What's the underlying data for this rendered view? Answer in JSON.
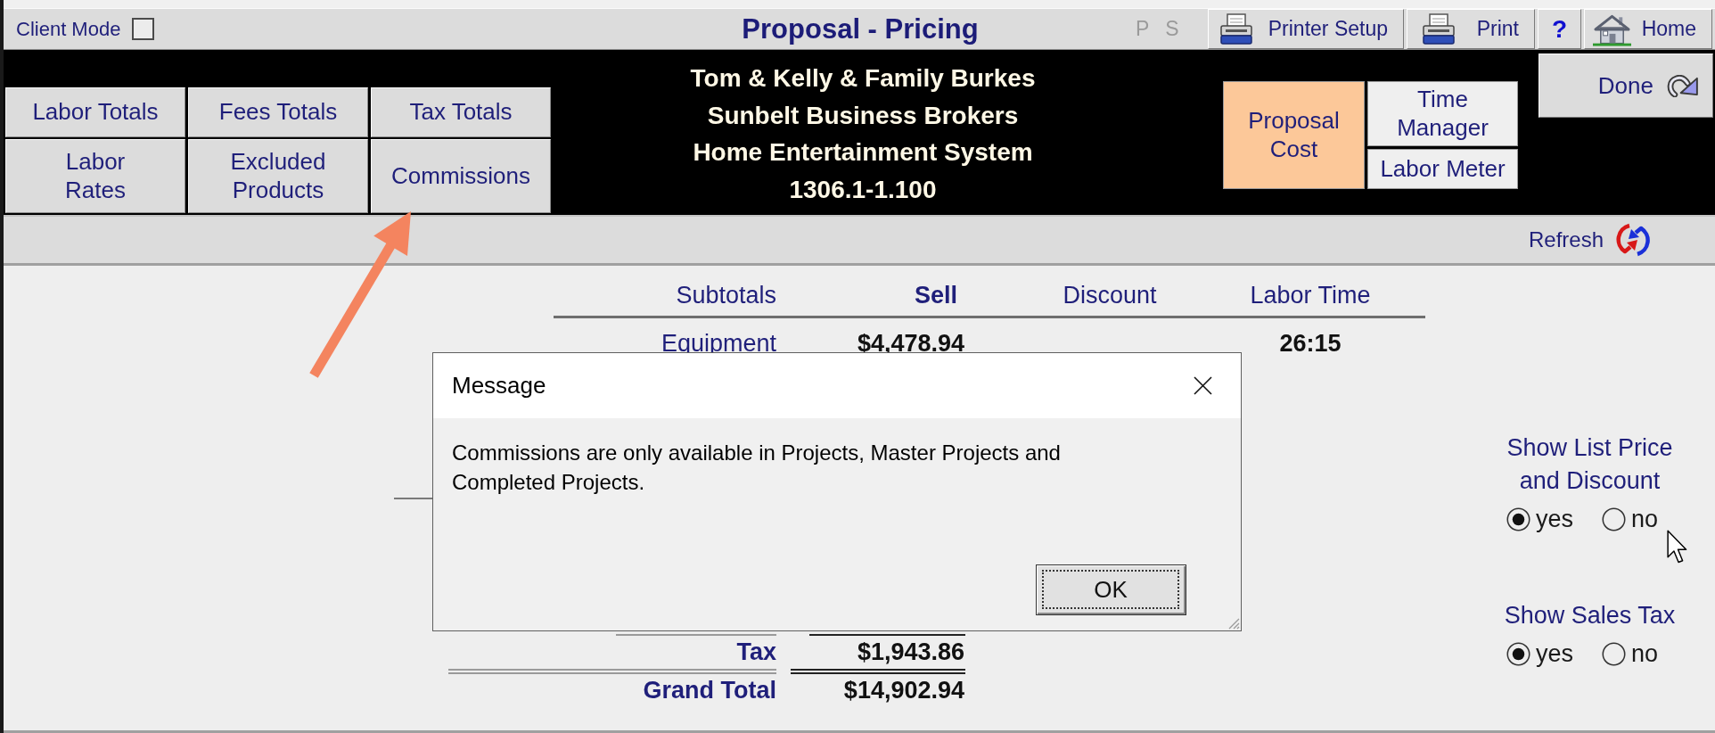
{
  "top_bar": {
    "client_mode": {
      "label": "Client Mode",
      "checked": false
    },
    "title": "Proposal - Pricing",
    "indicators": [
      "P",
      "S"
    ],
    "buttons": [
      {
        "kind": "printer-setup",
        "label": "Printer Setup"
      },
      {
        "kind": "print",
        "label": "Print"
      },
      {
        "kind": "help",
        "label": "?"
      },
      {
        "kind": "home",
        "label": "Home"
      }
    ]
  },
  "report_buttons": [
    "Labor Totals",
    "Fees Totals",
    "Tax Totals",
    "Labor\nRates",
    "Excluded\nProducts",
    "Commissions"
  ],
  "project_header": [
    "Tom & Kelly & Family Burkes",
    "Sunbelt Business Brokers",
    "Home Entertainment System",
    "1306.1-1.100"
  ],
  "view_buttons": [
    {
      "label": "Proposal\nCost",
      "selected": true
    },
    {
      "label": "Time\nManager",
      "selected": false
    },
    {
      "label": "Labor Meter",
      "selected": false
    }
  ],
  "done_button": "Done",
  "toolbar": {
    "refresh_button": "Refresh"
  },
  "table": {
    "columns": [
      {
        "label": "Subtotals",
        "bold": false
      },
      {
        "label": "Sell",
        "bold": true
      },
      {
        "label": "Discount",
        "bold": false
      },
      {
        "label": "Labor Time",
        "bold": false
      }
    ],
    "rows": [
      {
        "label": "Equipment",
        "sell": "$4,478.94",
        "labor_time": "26:15"
      }
    ],
    "totals": [
      {
        "kind": "sum",
        "label": "Tax",
        "sell": "$1,943.86"
      },
      {
        "kind": "grand",
        "label": "Grand Total",
        "sell": "$14,902.94"
      }
    ]
  },
  "display_options": [
    {
      "label": "Show List Price and Discount",
      "choices": [
        {
          "label": "yes",
          "selected": true
        },
        {
          "label": "no",
          "selected": false
        }
      ]
    },
    {
      "label": "Show Sales Tax",
      "choices": [
        {
          "label": "yes",
          "selected": true
        },
        {
          "label": "no",
          "selected": false
        }
      ]
    }
  ],
  "dialog": {
    "title": "Message",
    "message": "Commissions are only available in Projects, Master Projects and Completed Projects.",
    "button": "OK"
  }
}
